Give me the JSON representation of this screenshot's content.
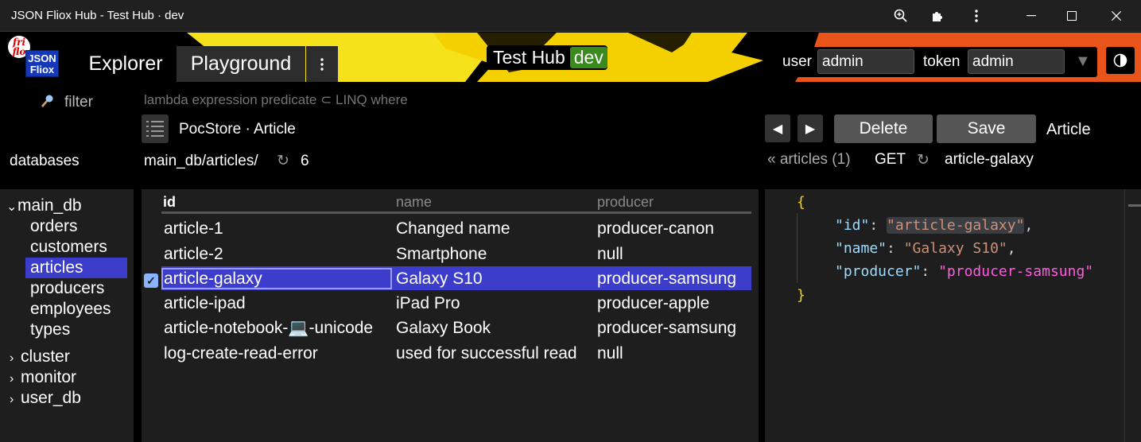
{
  "window": {
    "title": "JSON Fliox Hub - Test Hub · dev",
    "controls": [
      "zoom-icon",
      "extensions-icon",
      "more-icon",
      "minimize-icon",
      "maximize-icon",
      "close-icon"
    ]
  },
  "header": {
    "logo": {
      "ball_text_1": "fri",
      "ball_text_2": "flo",
      "box_line1": "JSON",
      "box_line2": "Fliox"
    },
    "tabs": [
      {
        "label": "Explorer",
        "active": true
      },
      {
        "label": "Playground",
        "active": false
      }
    ],
    "tab_menu_icon": "vertical-dots-icon",
    "hub": {
      "name": "Test Hub",
      "env": "dev",
      "env_color": "#3a8a1e"
    },
    "login": {
      "user_label": "user",
      "user_value": "admin",
      "token_label": "token",
      "token_value": "admin",
      "dropdown_icon": "triangle-down-icon"
    },
    "theme_icon": "half-circle-icon"
  },
  "toolbar": {
    "filter_label": "filter",
    "filter_icon": "search-icon",
    "filter_placeholder": "lambda expression predicate ⊂ LINQ where",
    "schema_icon": "list-icon",
    "container_path_db": "PocStore",
    "container_path_sep": "·",
    "container_path_type": "Article",
    "databases_label": "databases",
    "query_path": "main_db/articles/",
    "reload_icon": "↻",
    "count": "6",
    "prev_icon": "◀",
    "next_icon": "▶",
    "delete_label": "Delete",
    "save_label": "Save",
    "entity_type": "Article",
    "back_link": "« articles (1)",
    "method": "GET",
    "entity_reload_icon": "↻",
    "entity_id": "article-galaxy"
  },
  "sidebar": {
    "databases": [
      {
        "name": "main_db",
        "expanded": true,
        "containers": [
          "orders",
          "customers",
          "articles",
          "producers",
          "employees",
          "types"
        ],
        "selected": "articles"
      },
      {
        "name": "cluster",
        "expanded": false
      },
      {
        "name": "monitor",
        "expanded": false
      },
      {
        "name": "user_db",
        "expanded": false
      }
    ]
  },
  "table": {
    "columns": [
      "id",
      "name",
      "producer"
    ],
    "rows": [
      {
        "id": "article-1",
        "name": "Changed name",
        "producer": "producer-canon"
      },
      {
        "id": "article-2",
        "name": "Smartphone",
        "producer": "null"
      },
      {
        "id": "article-galaxy",
        "name": "Galaxy S10",
        "producer": "producer-samsung",
        "selected": true
      },
      {
        "id": "article-ipad",
        "name": "iPad Pro",
        "producer": "producer-apple"
      },
      {
        "id": "article-notebook-💻-unicode",
        "name": "Galaxy Book",
        "producer": "producer-samsung"
      },
      {
        "id": "log-create-read-error",
        "name": "used for successful read",
        "producer": "null"
      }
    ],
    "selection_color": "#3d3dcc"
  },
  "editor": {
    "open_brace": "{",
    "close_brace": "}",
    "fields": [
      {
        "key": "\"id\"",
        "value": "\"article-galaxy\""
      },
      {
        "key": "\"name\"",
        "value": "\"Galaxy S10\""
      },
      {
        "key": "\"producer\"",
        "value": "\"producer-samsung\""
      }
    ]
  }
}
